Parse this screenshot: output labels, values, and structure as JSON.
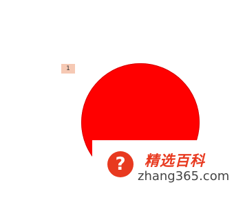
{
  "slide": {
    "number": "1",
    "number_badge_color": "#f6c9b4",
    "shape": "circle",
    "shape_color": "#ff0000"
  },
  "watermark": {
    "logo_icon": "question-mark-icon",
    "logo_glyph": "?",
    "logo_color": "#e8391f",
    "title": "精选百科",
    "url": "zhang365.com"
  }
}
